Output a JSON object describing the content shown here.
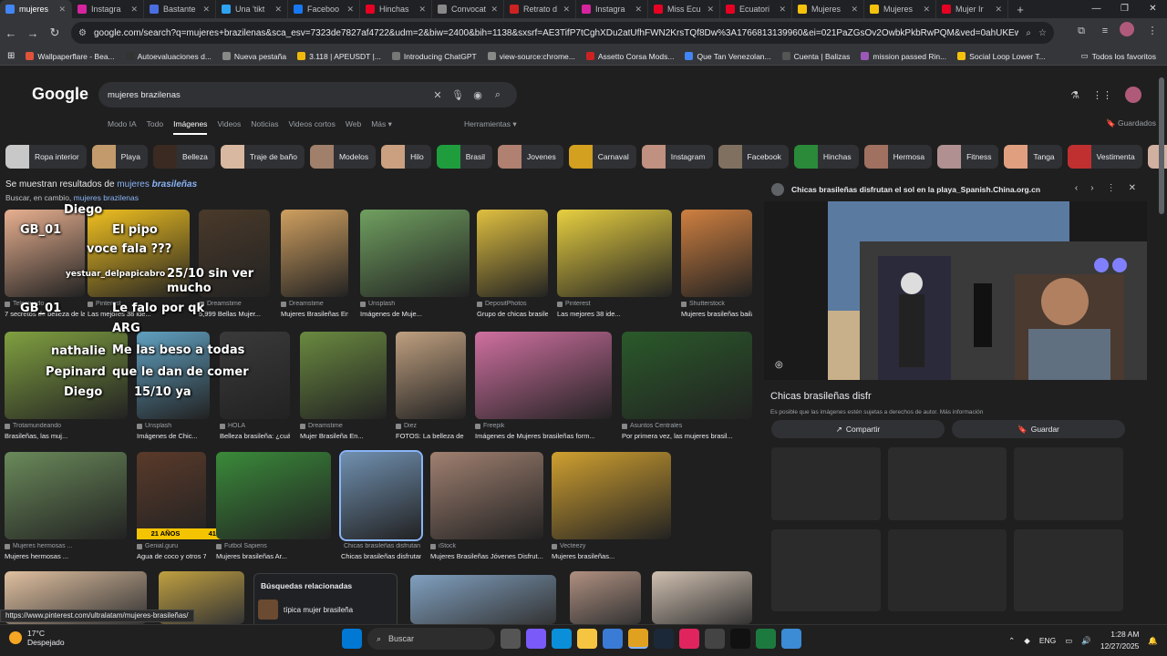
{
  "tabs": [
    {
      "label": "mujeres",
      "color": "#4285f4",
      "active": true
    },
    {
      "label": "Instagra",
      "color": "#d6249f"
    },
    {
      "label": "Bastante",
      "color": "#4a6ee0"
    },
    {
      "label": "Una 'tikt",
      "color": "#2ea3f2"
    },
    {
      "label": "Faceboo",
      "color": "#1877f2"
    },
    {
      "label": "Hinchas",
      "color": "#e60023"
    },
    {
      "label": "Convocat",
      "color": "#888888"
    },
    {
      "label": "Retrato d",
      "color": "#cc2222"
    },
    {
      "label": "Instagra",
      "color": "#d6249f"
    },
    {
      "label": "Miss Ecu",
      "color": "#e60023"
    },
    {
      "label": "Ecuatori",
      "color": "#e60023"
    },
    {
      "label": "Mujeres",
      "color": "#f4c20d"
    },
    {
      "label": "Mujeres",
      "color": "#f4c20d"
    },
    {
      "label": "Mujer Ir",
      "color": "#e60023"
    }
  ],
  "address": {
    "url": "google.com/search?q=mujeres+brazilenas&sca_esv=7323de7827af4722&udm=2&biw=2400&bih=1138&sxsrf=AE3TifP7tCghXDu2atUfhFWN2KrsTQf8Dw%3A1766813139960&ei=021PaZGsOv2OwbkPkbRwPQM&ved=0ahUKEwjR4d3sg92RAx..."
  },
  "bookmarks": [
    {
      "label": "Wallpaperflare - Bea...",
      "color": "#e0533a"
    },
    {
      "label": "Autoevaluaciones d...",
      "color": "#333333"
    },
    {
      "label": "Nueva pestaña",
      "color": "#888888"
    },
    {
      "label": "3.118 | APEUSDT |...",
      "color": "#f0b90b"
    },
    {
      "label": "Introducing ChatGPT",
      "color": "#777777"
    },
    {
      "label": "view-source:chrome...",
      "color": "#888888"
    },
    {
      "label": "Assetto Corsa Mods...",
      "color": "#cc2222"
    },
    {
      "label": "Que Tan Venezolan...",
      "color": "#4285f4"
    },
    {
      "label": "Cuenta | Balizas",
      "color": "#555555"
    },
    {
      "label": "mission passed Rin...",
      "color": "#9b59b6"
    },
    {
      "label": "Social Loop Lower T...",
      "color": "#f4c20d"
    }
  ],
  "bookmarks_all": "Todos los favoritos",
  "google": {
    "logo": "Google",
    "query": "mujeres brazilenas"
  },
  "nav_tabs": [
    "Modo IA",
    "Todo",
    "Imágenes",
    "Videos",
    "Noticias",
    "Videos cortos",
    "Web",
    "Más ▾"
  ],
  "herramientas": "Herramientas ▾",
  "guardados": "Guardados",
  "chips": [
    {
      "label": "Ropa interior",
      "color": "#c8c8c8"
    },
    {
      "label": "Playa",
      "color": "#c29a6c"
    },
    {
      "label": "Belleza",
      "color": "#3b2a22"
    },
    {
      "label": "Traje de baño",
      "color": "#d8b8a0"
    },
    {
      "label": "Modelos",
      "color": "#a0806a"
    },
    {
      "label": "Hilo",
      "color": "#caa080"
    },
    {
      "label": "Brasil",
      "color": "#1f9d3d"
    },
    {
      "label": "Jovenes",
      "color": "#b08070"
    },
    {
      "label": "Carnaval",
      "color": "#d4a020"
    },
    {
      "label": "Instagram",
      "color": "#c09080"
    },
    {
      "label": "Facebook",
      "color": "#807060"
    },
    {
      "label": "Hinchas",
      "color": "#2a8a3a"
    },
    {
      "label": "Hermosa",
      "color": "#a07060"
    },
    {
      "label": "Fitness",
      "color": "#b09090"
    },
    {
      "label": "Tanga",
      "color": "#e0a080"
    },
    {
      "label": "Vestimenta",
      "color": "#c03030"
    },
    {
      "label": "Tiktok",
      "color": "#d0b0a0"
    }
  ],
  "notice": {
    "prefix": "Se muestran resultados de",
    "link": "mujeres",
    "bold": "brasileñas",
    "alt_prefix": "Buscar, en cambio,",
    "alt_link": "mujeres brazilenas"
  },
  "results": [
    {
      "src": "Telemundo",
      "cap": "7 secretos de belleza de las ...",
      "color": "#e8b090",
      "row": 0
    },
    {
      "src": "Pinterest",
      "cap": "Las mejores 38 ide...",
      "color": "#f0c020",
      "row": 0
    },
    {
      "src": "Dreamstime",
      "cap": "5,999 Bellas Mujer...",
      "color": "#4a3a2a",
      "row": 0
    },
    {
      "src": "Dreamstime",
      "cap": "Mujeres Brasileñas En Bikini E...",
      "color": "#d0a060",
      "row": 0
    },
    {
      "src": "Unsplash",
      "cap": "Imágenes de Muje...",
      "color": "#70a060",
      "row": 0
    },
    {
      "src": "DepositPhotos",
      "cap": "Grupo de chicas brasileñas felice...",
      "color": "#e0c040",
      "row": 0
    },
    {
      "src": "Pinterest",
      "cap": "Las mejores 38 ide...",
      "color": "#e8d040",
      "row": 0
    },
    {
      "src": "Shutterstock",
      "cap": "Mujeres brasileñas bailan samba e...",
      "color": "#d08040",
      "row": 1
    },
    {
      "src": "Trotamundeando",
      "cap": "Brasileñas, las muj...",
      "color": "#80a040",
      "row": 1
    },
    {
      "src": "Unsplash",
      "cap": "Imágenes de Chic...",
      "color": "#60a0c0",
      "row": 1
    },
    {
      "src": "HOLA",
      "cap": "Belleza brasileña: ¿cuál...",
      "color": "#3a3a3a",
      "row": 1
    },
    {
      "src": "Dreamstime",
      "cap": "Mujer Brasileña En...",
      "color": "#6a8a40",
      "row": 1
    },
    {
      "src": "Diez",
      "cap": "FOTOS: La belleza de la mujer brasileñ...",
      "color": "#c0a080",
      "row": 1
    },
    {
      "src": "Freepik",
      "cap": "Imágenes de Mujeres brasileñas form...",
      "color": "#d070a0",
      "row": 1
    },
    {
      "src": "Asuntos Centrales",
      "cap": "Por primera vez, las mujeres brasil...",
      "color": "#2a5a2a",
      "row": 2
    },
    {
      "src": "Mujeres hermosas ...",
      "cap": "Mujeres hermosas ...",
      "color": "#6a8a5a",
      "row": 2
    },
    {
      "src": "Genial.guru",
      "cap": "Agua de coco y otros 7 secretos ...",
      "color": "#5a3a2a",
      "row": 2
    },
    {
      "src": "Futbol Sapiens",
      "cap": "Mujeres brasileñas Ar...",
      "color": "#3a8a3a",
      "row": 2
    },
    {
      "src": "Chicas brasileñas disfrutan el sol en",
      "cap": "Chicas brasileñas disfrutan el s...",
      "color": "#7090b0",
      "row": 2,
      "selected": true
    },
    {
      "src": "iStock",
      "cap": "Mujeres Brasileñas Jóvenes Disfrut...",
      "color": "#a08070",
      "row": 2
    },
    {
      "src": "Vecteezy",
      "cap": "Mujeres brasileñas...",
      "color": "#d0a030",
      "row": 2
    }
  ],
  "age_labels": [
    "21 AÑOS",
    "41 AÑOS"
  ],
  "related": {
    "title": "Búsquedas relacionadas",
    "item": "típica mujer brasileña"
  },
  "chat_overlay": [
    "GB_01",
    "El pipo",
    "voce fala ???",
    "yestuar_delpapicabro",
    "25/10 sin ver",
    "mucho",
    "GB_01",
    "Le falo por qk",
    "ARG",
    "nathalie",
    "Me las beso a todas",
    "Pepinard",
    "que le dan de comer",
    "Diego",
    "15/10 ya",
    "Diego"
  ],
  "panel": {
    "source": "Chicas brasileñas disfrutan el sol en la playa_Spanish.China.org.cn",
    "title": "Chicas brasileñas disfr",
    "note": "Es posible que las imágenes estén sujetas a derechos de autor. Más información",
    "share": "Compartir",
    "save": "Guardar"
  },
  "status_url": "https://www.pinterest.com/ultralatam/mujeres-brasileñas/",
  "taskbar": {
    "temp": "17°C",
    "weather": "Despejado",
    "search": "Buscar",
    "lang": "ENG",
    "time": "1:28 AM",
    "date": "12/27/2025"
  }
}
